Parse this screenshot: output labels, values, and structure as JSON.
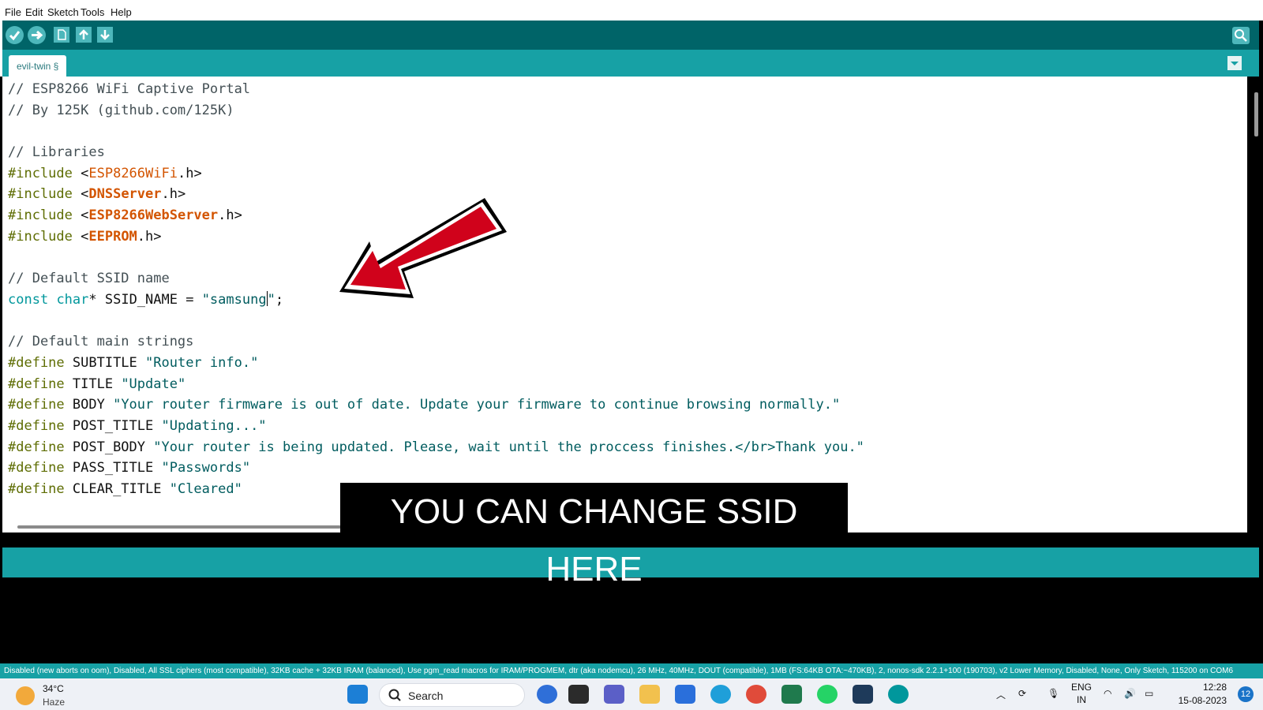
{
  "menu": [
    "File",
    "Edit",
    "Sketch",
    "Tools",
    "Help"
  ],
  "tab": {
    "label": "evil-twin §"
  },
  "code_lines": [
    [
      {
        "t": "// ESP8266 WiFi Captive Portal",
        "c": "cm"
      }
    ],
    [
      {
        "t": "// By 125K (github.com/125K)",
        "c": "cm"
      }
    ],
    [],
    [
      {
        "t": "// Libraries",
        "c": "cm"
      }
    ],
    [
      {
        "t": "#include",
        "c": "pp"
      },
      {
        "t": " <"
      },
      {
        "t": "ESP8266WiFi",
        "c": "lb"
      },
      {
        "t": ".h>"
      }
    ],
    [
      {
        "t": "#include",
        "c": "pp"
      },
      {
        "t": " <"
      },
      {
        "t": "DNSServer",
        "c": "lbb"
      },
      {
        "t": ".h>"
      }
    ],
    [
      {
        "t": "#include",
        "c": "pp"
      },
      {
        "t": " <"
      },
      {
        "t": "ESP8266WebServer",
        "c": "lbb"
      },
      {
        "t": ".h>"
      }
    ],
    [
      {
        "t": "#include",
        "c": "pp"
      },
      {
        "t": " <"
      },
      {
        "t": "EEPROM",
        "c": "lbb"
      },
      {
        "t": ".h>"
      }
    ],
    [],
    [
      {
        "t": "// Default SSID name",
        "c": "cm"
      }
    ],
    [
      {
        "t": "const",
        "c": "kw"
      },
      {
        "t": " "
      },
      {
        "t": "char",
        "c": "kw"
      },
      {
        "t": "* SSID_NAME = "
      },
      {
        "t": "\"samsung",
        "c": "st"
      },
      {
        "caret": true
      },
      {
        "t": "\"",
        "c": "st"
      },
      {
        "t": ";"
      }
    ],
    [],
    [
      {
        "t": "// Default main strings",
        "c": "cm"
      }
    ],
    [
      {
        "t": "#define",
        "c": "pp"
      },
      {
        "t": " SUBTITLE "
      },
      {
        "t": "\"Router info.\"",
        "c": "st"
      }
    ],
    [
      {
        "t": "#define",
        "c": "pp"
      },
      {
        "t": " TITLE "
      },
      {
        "t": "\"Update\"",
        "c": "st"
      }
    ],
    [
      {
        "t": "#define",
        "c": "pp"
      },
      {
        "t": " BODY "
      },
      {
        "t": "\"Your router firmware is out of date. Update your firmware to continue browsing normally.\"",
        "c": "st"
      }
    ],
    [
      {
        "t": "#define",
        "c": "pp"
      },
      {
        "t": " POST_TITLE "
      },
      {
        "t": "\"Updating...\"",
        "c": "st"
      }
    ],
    [
      {
        "t": "#define",
        "c": "pp"
      },
      {
        "t": " POST_BODY "
      },
      {
        "t": "\"Your router is being updated. Please, wait until the proccess finishes.</br>Thank you.\"",
        "c": "st"
      }
    ],
    [
      {
        "t": "#define",
        "c": "pp"
      },
      {
        "t": " PASS_TITLE "
      },
      {
        "t": "\"Passwords\"",
        "c": "st"
      }
    ],
    [
      {
        "t": "#define",
        "c": "pp"
      },
      {
        "t": " CLEAR_TITLE "
      },
      {
        "t": "\"Cleared\"",
        "c": "st"
      }
    ]
  ],
  "caption": "YOU CAN CHANGE SSID HERE",
  "status_bar": "Disabled (new aborts on oom), Disabled, All SSL ciphers (most compatible), 32KB cache + 32KB IRAM (balanced), Use pgm_read macros for IRAM/PROGMEM, dtr (aka nodemcu), 26 MHz, 40MHz, DOUT (compatible), 1MB (FS:64KB OTA:~470KB), 2, nonos-sdk 2.2.1+100 (190703), v2 Lower Memory, Disabled, None, Only Sketch, 115200 on COM6",
  "taskbar": {
    "temperature": "34°C",
    "condition": "Haze",
    "search_label": "Search",
    "lang_top": "ENG",
    "lang_bottom": "IN",
    "time": "12:28",
    "date": "15-08-2023",
    "notifications": "12"
  },
  "colors": {
    "toolbar": "#006468",
    "tabrow": "#17a1a5",
    "arrow": "#d0021b"
  }
}
